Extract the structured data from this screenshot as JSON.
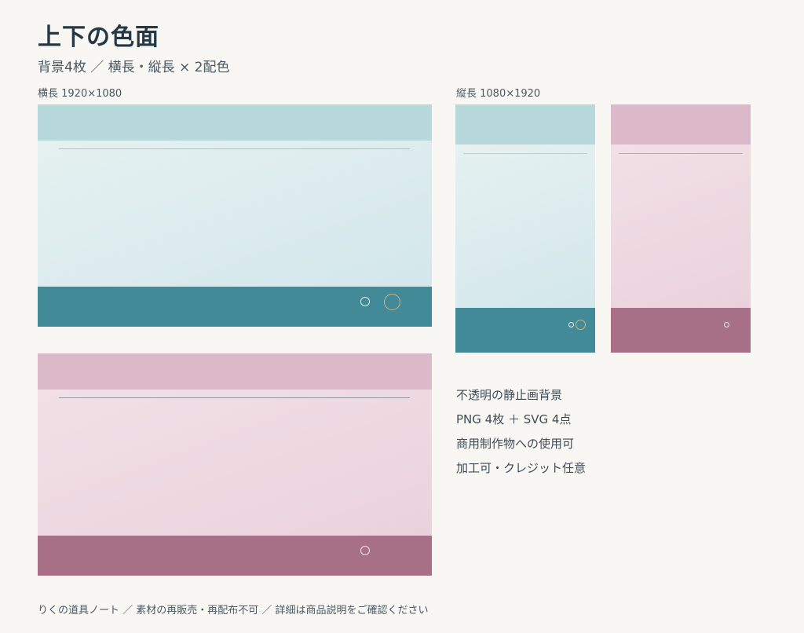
{
  "page": {
    "title": "上下の色面",
    "subtitle": "背景4枚 ／ 横長・縦長 × 2配色",
    "footer": "りくの道具ノート ／ 素材の再販売・再配布不可 ／ 詳細は商品説明をご確認ください"
  },
  "labels": {
    "landscape": "横長 1920×1080",
    "portrait": "縦長 1080×1920"
  },
  "palettes": {
    "teal": {
      "top_band": "#b8d9dc",
      "middle_from": "#e6f1f1",
      "middle_to": "#d3e7eb",
      "bottom_band": "#428a98",
      "rule": "#d7b98a",
      "ring_small": "#e8f1f3",
      "ring_large": "#d8b36a"
    },
    "rose": {
      "top_band": "#dbb9c8",
      "middle_from": "#f2e0e6",
      "middle_to": "#ead2dc",
      "bottom_band": "#a87086",
      "rule": "#8e9aa0",
      "ring_small": "#f3e4ea",
      "ring_large": "#a67087"
    }
  },
  "features": [
    "不透明の静止画背景",
    "PNG 4枚 ＋ SVG 4点",
    "商用制作物への使用可",
    "加工可・クレジット任意"
  ]
}
